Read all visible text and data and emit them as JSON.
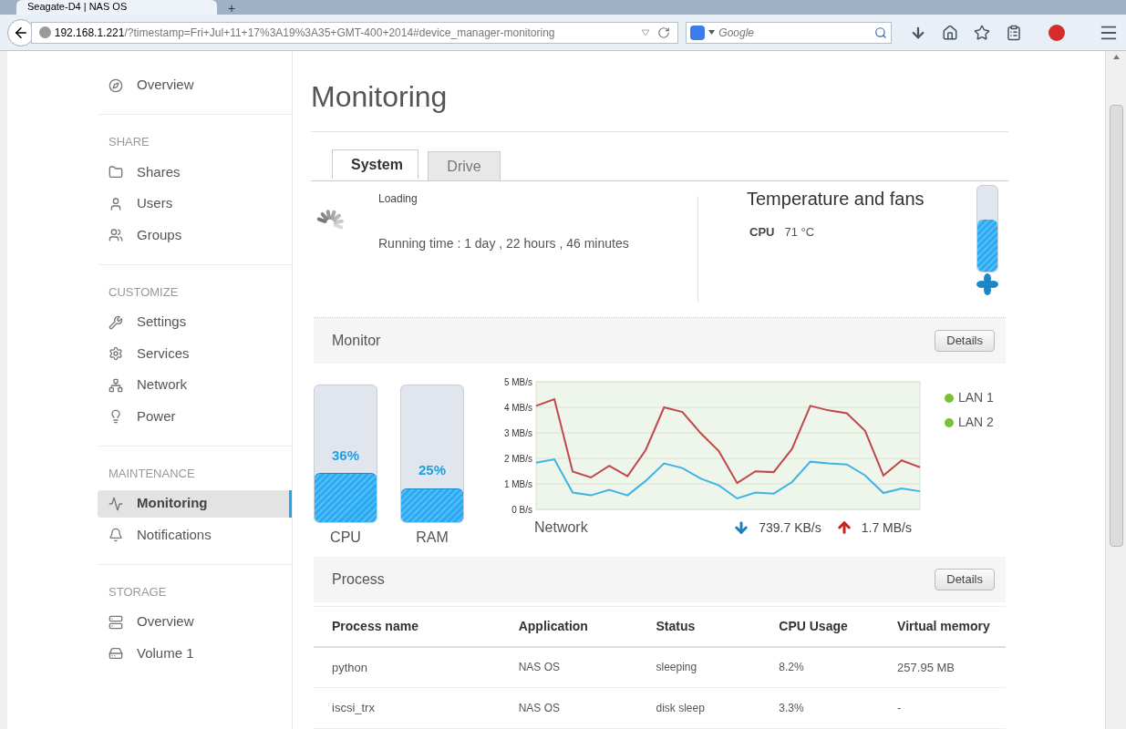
{
  "browser": {
    "tab_title": "Seagate-D4 | NAS OS",
    "new_tab": "+",
    "url_host": "192.168.1.221",
    "url_path": "/?timestamp=Fri+Jul+11+17%3A19%3A35+GMT-400+2014#device_manager-monitoring",
    "search_placeholder": "Google"
  },
  "sidebar": {
    "sections": [
      {
        "items": [
          {
            "label": "Overview",
            "selected": false
          }
        ]
      },
      {
        "heading": "SHARE",
        "items": [
          {
            "label": "Shares",
            "selected": false
          },
          {
            "label": "Users",
            "selected": false
          },
          {
            "label": "Groups",
            "selected": false
          }
        ]
      },
      {
        "heading": "CUSTOMIZE",
        "items": [
          {
            "label": "Settings",
            "selected": false
          },
          {
            "label": "Services",
            "selected": false
          },
          {
            "label": "Network",
            "selected": false
          },
          {
            "label": "Power",
            "selected": false
          }
        ]
      },
      {
        "heading": "MAINTENANCE",
        "items": [
          {
            "label": "Monitoring",
            "selected": true
          },
          {
            "label": "Notifications",
            "selected": false
          }
        ]
      },
      {
        "heading": "STORAGE",
        "items": [
          {
            "label": "Overview",
            "selected": false
          },
          {
            "label": "Volume 1",
            "selected": false
          }
        ]
      }
    ]
  },
  "page_title": "Monitoring",
  "tabs": [
    {
      "label": "System",
      "selected": true
    },
    {
      "label": "Drive",
      "selected": false
    }
  ],
  "system": {
    "status": "Loading",
    "running_time": "Running time : 1 day , 22 hours , 46 minutes"
  },
  "temperature": {
    "title": "Temperature and fans",
    "sensor": "CPU",
    "value": "71 °C",
    "level": 0.61
  },
  "monitor": {
    "title": "Monitor",
    "details": "Details",
    "gauges": [
      {
        "label": "CPU",
        "value": "36%",
        "level": 0.36
      },
      {
        "label": "RAM",
        "value": "25%",
        "level": 0.25
      }
    ],
    "network": {
      "title": "Network",
      "download": "739.7 KB/s",
      "upload": "1.7 MB/s",
      "legend": [
        {
          "color": "#7cbf3a"
        },
        {
          "color": "#7cbf3a"
        }
      ],
      "chart_data": {
        "type": "line",
        "grid": true,
        "ylim": [
          0,
          5
        ],
        "yticks": [
          {
            "value": 0,
            "label": "0 B/s"
          },
          {
            "value": 1,
            "label": "1 MB/s"
          },
          {
            "value": 2,
            "label": "2 MB/s"
          },
          {
            "value": 3,
            "label": "3 MB/s"
          },
          {
            "value": 4,
            "label": "4 MB/s"
          },
          {
            "value": 5,
            "label": "5 MB/s"
          }
        ],
        "series": [
          {
            "name": "LAN 1",
            "color": "#c0474a",
            "values": [
              4.06,
              4.32,
              1.48,
              1.25,
              1.71,
              1.3,
              2.33,
              4.0,
              3.82,
              2.99,
              2.28,
              1.03,
              1.49,
              1.46,
              2.37,
              4.06,
              3.88,
              3.77,
              3.08,
              1.33,
              1.92,
              1.65
            ]
          },
          {
            "name": "LAN 2",
            "color": "#3fb3e3",
            "values": [
              1.83,
              1.96,
              0.66,
              0.55,
              0.77,
              0.55,
              1.12,
              1.8,
              1.62,
              1.21,
              0.94,
              0.43,
              0.66,
              0.62,
              1.07,
              1.87,
              1.8,
              1.76,
              1.33,
              0.64,
              0.82,
              0.71
            ]
          }
        ]
      }
    }
  },
  "process": {
    "title": "Process",
    "details": "Details",
    "columns": [
      "Process name",
      "Application",
      "Status",
      "CPU Usage",
      "Virtual memory"
    ],
    "rows": [
      [
        "python",
        "NAS OS",
        "sleeping",
        "8.2%",
        "257.95 MB"
      ],
      [
        "iscsi_trx",
        "NAS OS",
        "disk sleep",
        "3.3%",
        "-"
      ]
    ]
  }
}
